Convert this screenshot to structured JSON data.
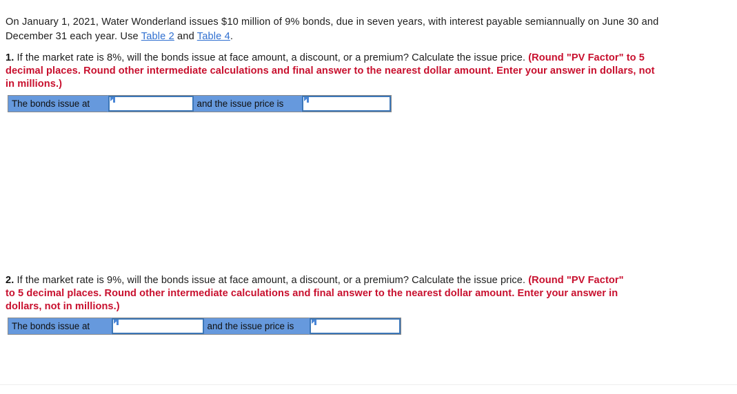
{
  "intro": {
    "part1": "On January 1, 2021, Water Wonderland issues $10 million of 9% bonds, due in seven years, with interest payable semiannually on June 30 and December 31 each year. Use ",
    "link1": "Table 2",
    "between": " and ",
    "link2": "Table 4",
    "part2": "."
  },
  "questions": [
    {
      "number": "1.",
      "body": " If the market rate is 8%, will the bonds issue at face amount, a discount, or a premium? Calculate the issue price. ",
      "instruction": "(Round \"PV Factor\" to 5 decimal places. Round other intermediate calculations and final answer to the nearest dollar amount. Enter your answer in dollars, not in millions.)"
    },
    {
      "number": "2.",
      "body": " If the market rate is 9%, will the bonds issue at face amount, a discount, or a premium? Calculate the issue price. ",
      "instruction": "(Round \"PV Factor\" to 5 decimal places. Round other intermediate calculations and final answer to the nearest dollar amount. Enter your answer in dollars, not in millions.)"
    }
  ],
  "answer_tables": [
    {
      "label_1": "The bonds issue at",
      "value_1": "",
      "placeholder_1": "",
      "label_2": "and the issue price is",
      "value_2": "",
      "placeholder_2": ""
    },
    {
      "label_1": "The bonds issue at",
      "value_1": "",
      "placeholder_1": "",
      "label_2": "and the issue price is",
      "value_2": "",
      "placeholder_2": ""
    }
  ],
  "colors": {
    "cell_blue": "#6699dd",
    "input_border_blue": "#3c77b8",
    "instruction_red": "#c8102e",
    "link_blue": "#2f6fd0"
  }
}
